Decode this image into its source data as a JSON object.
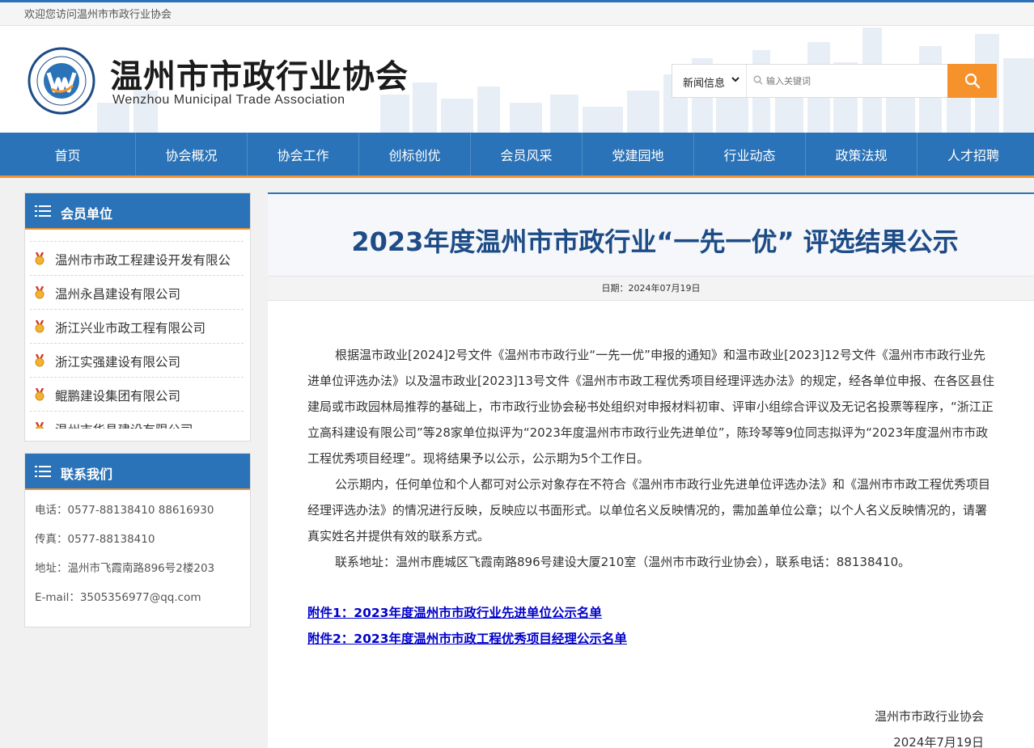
{
  "topbar": {
    "welcome": "欢迎您访问温州市市政行业协会"
  },
  "header": {
    "title": "温州市市政行业协会",
    "subtitle": "Wenzhou Municipal Trade Association",
    "logo_icon": "association-logo-icon"
  },
  "search": {
    "category": "新闻信息",
    "placeholder": "输入关键词",
    "button_icon": "search-icon",
    "button_color": "#f5922b"
  },
  "nav": {
    "items": [
      "首页",
      "协会概况",
      "协会工作",
      "创标创优",
      "会员风采",
      "党建园地",
      "行业动态",
      "政策法规",
      "人才招聘"
    ]
  },
  "members": {
    "heading": "会员单位",
    "items": [
      "温州市市政工程建设开发有限公",
      "温州永昌建设有限公司",
      "浙江兴业市政工程有限公司",
      "浙江实强建设有限公司",
      "鲲鹏建设集团有限公司",
      "温州市华昌建设有限公司"
    ]
  },
  "contact": {
    "heading": "联系我们",
    "phone": "电话：0577-88138410 88616930",
    "fax": "传真：0577-88138410",
    "address": "地址：温州市飞霞南路896号2楼203",
    "email": "E-mail：3505356977@qq.com"
  },
  "article": {
    "title": "2023年度温州市市政行业“一先一优” 评选结果公示",
    "date": "日期：2024年07月19日",
    "paragraphs": [
      "根据温市政业[2024]2号文件《温州市市政行业“一先一优”申报的通知》和温市政业[2023]12号文件《温州市市政行业先进单位评选办法》以及温市政业[2023]13号文件《温州市市政工程优秀项目经理评选办法》的规定，经各单位申报、在各区县住建局或市政园林局推荐的基础上，市市政行业协会秘书处组织对申报材料初审、评审小组综合评议及无记名投票等程序，“浙江正立高科建设有限公司”等28家单位拟评为“2023年度温州市市政行业先进单位”，陈玲琴等9位同志拟评为“2023年度温州市市政工程优秀项目经理”。现将结果予以公示，公示期为5个工作日。",
      "公示期内，任何单位和个人都可对公示对象存在不符合《温州市市政行业先进单位评选办法》和《温州市市政工程优秀项目经理评选办法》的情况进行反映，反映应以书面形式。以单位名义反映情况的，需加盖单位公章；以个人名义反映情况的，请署真实姓名并提供有效的联系方式。",
      "联系地址：温州市鹿城区飞霞南路896号建设大厦210室（温州市市政行业协会），联系电话：88138410。"
    ],
    "attachments": [
      "附件1：2023年度温州市市政行业先进单位公示名单",
      "附件2：2023年度温州市市政工程优秀项目经理公示名单"
    ],
    "signature": "温州市市政行业协会",
    "sign_date": "2024年7月19日"
  }
}
